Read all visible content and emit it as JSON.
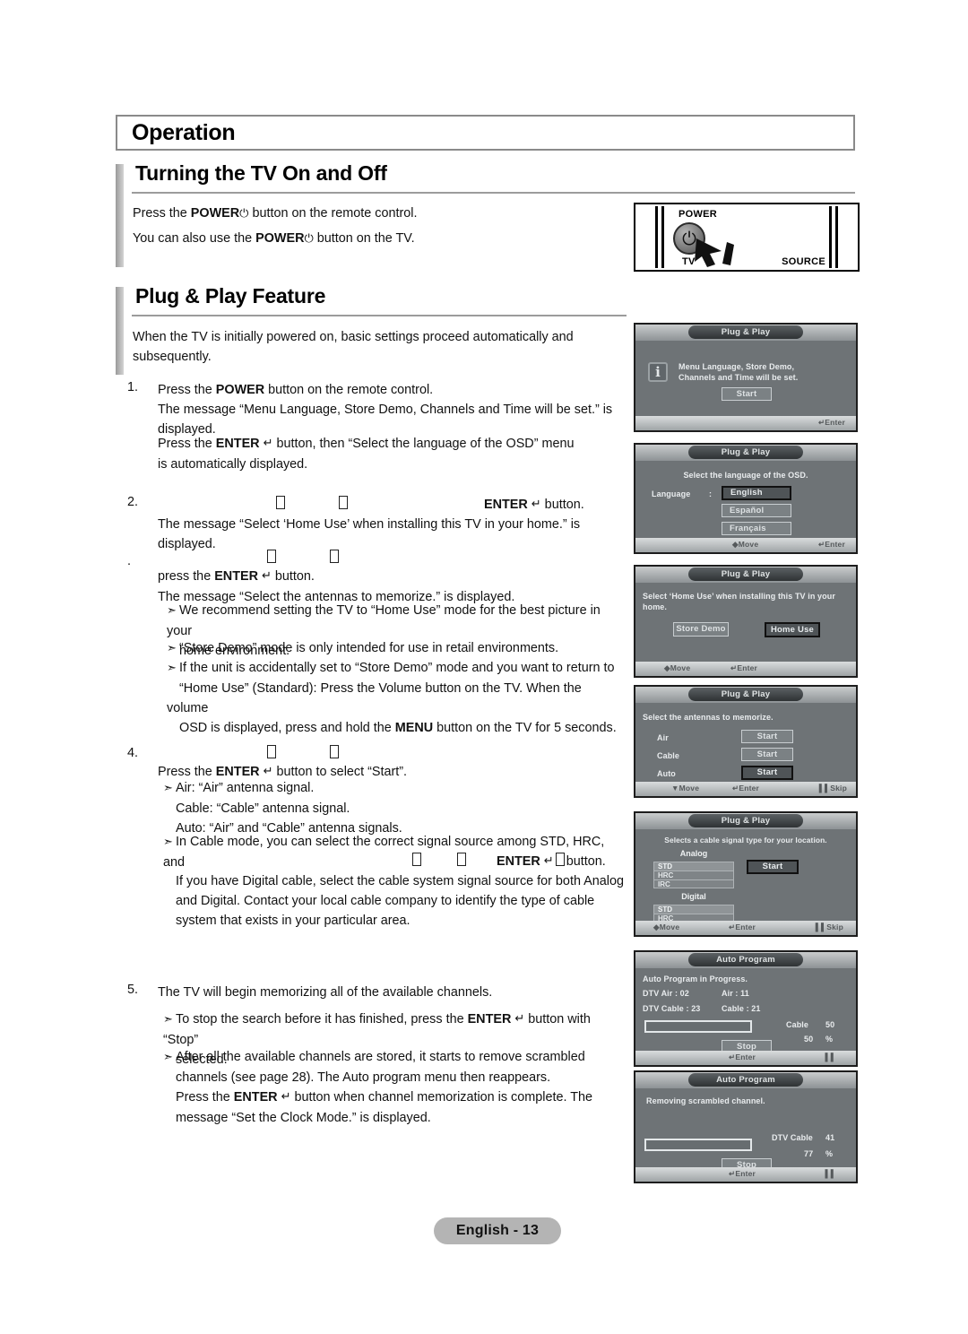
{
  "chapter": {
    "title": "Operation"
  },
  "sections": {
    "turning_on": {
      "title": "Turning the TV On and Off",
      "line1_pre": "Press the ",
      "line1_bold": "POWER",
      "line1_post": " button on the remote control.",
      "line2_pre": "You can also use the ",
      "line2_bold": "POWER",
      "line2_post": " button on the TV."
    },
    "plug_play": {
      "title": "Plug & Play Feature",
      "intro": "When the TV is initially powered on, basic settings proceed automatically and subsequently."
    }
  },
  "power_figure": {
    "power_label": "POWER",
    "tv_label": "TV",
    "source_label": "SOURCE",
    "power_glyph": "⏻"
  },
  "steps": {
    "s1": {
      "num": "1.",
      "l1_pre": "Press the ",
      "l1_bold": "POWER",
      "l1_post": " button on the remote control.",
      "l2": "The message “Menu Language, Store Demo, Channels and Time will be set.” is",
      "l3": "displayed.",
      "l4_pre": "Press the ",
      "l4_bold": "ENTER",
      "l4_post": " button, then “Select the language of the OSD” menu",
      "l5": "is automatically displayed."
    },
    "s2": {
      "num": "2.",
      "l1_bold": "ENTER",
      "l1_post": " button.",
      "l2": "The message “Select ‘Home Use’ when installing this TV in your home.” is",
      "l3": "displayed."
    },
    "s3": {
      "num": ".",
      "l2_pre": "press the ",
      "l2_bold": "ENTER",
      "l2_post": " button.",
      "l3": "The message “Select the antennas to memorize.” is displayed.",
      "b1_a": "We recommend setting the TV to “Home Use” mode for the best picture in your",
      "b1_b": "home environment.",
      "b2": "“Store Demo” mode is only intended for use in retail environments.",
      "b3_a": "If the unit is accidentally set to “Store Demo” mode and you want to return to",
      "b3_b": "“Home Use” (Standard): Press the Volume button on the TV. When the volume",
      "b3_c_pre": "OSD is displayed, press and hold the ",
      "b3_c_bold": "MENU",
      "b3_c_post": " button on the TV for 5 seconds."
    },
    "s4": {
      "num": "4.",
      "l1_pre": "Press the ",
      "l1_bold": "ENTER",
      "l1_post": " button to select “Start”.",
      "b1_a": "Air: “Air” antenna signal.",
      "b1_b": "Cable: “Cable” antenna signal.",
      "b1_c": "Auto: “Air” and “Cable” antenna signals.",
      "b2_a": "In Cable mode, you can select the correct signal source among STD, HRC, and",
      "b2_b_bold": "ENTER",
      "b2_b_post": "button.",
      "b2_c": "If you have Digital cable, select the cable system signal source for both Analog",
      "b2_d": "and Digital. Contact your local cable company to identify the type of cable",
      "b2_e": "system that exists in your particular area."
    },
    "s5": {
      "num": "5.",
      "l1": "The TV will begin memorizing all of the available channels.",
      "b1_a_pre": "To stop the search before it has finished, press the ",
      "b1_a_bold": "ENTER",
      "b1_a_post": " button with “Stop”",
      "b1_b": "selected.",
      "b2_a": "After all the available channels are stored, it starts to remove scrambled",
      "b2_b": "channels (see page 28). The Auto program menu then reappears.",
      "b2_c_pre": "Press the ",
      "b2_c_bold": "ENTER",
      "b2_c_post": " button when channel memorization is complete. The",
      "b2_d": "message “Set the Clock Mode.” is displayed."
    }
  },
  "osd": {
    "p1": {
      "title": "Plug & Play",
      "info_glyph": "i",
      "msg_l1": "Menu Language, Store Demo,",
      "msg_l2": "Channels and Time will be set.",
      "start": "Start",
      "hint_enter": "Enter"
    },
    "p2": {
      "title": "Plug & Play",
      "msg": "Select the language of the OSD.",
      "language_label": "Language",
      "colon": ":",
      "options": [
        "English",
        "Español",
        "Français"
      ],
      "hint_move": "Move",
      "hint_enter": "Enter"
    },
    "p3": {
      "title": "Plug & Play",
      "msg_l1": "Select ‘Home Use’ when installing this TV in your",
      "msg_l2": "home.",
      "store_demo": "Store Demo",
      "home_use": "Home Use",
      "hint_move": "Move",
      "hint_enter": "Enter"
    },
    "p4": {
      "title": "Plug & Play",
      "msg": "Select the antennas to memorize.",
      "rows": [
        "Air",
        "Cable",
        "Auto"
      ],
      "start": "Start",
      "hint_move": "Move",
      "hint_enter": "Enter",
      "hint_skip": "Skip"
    },
    "p5": {
      "title": "Plug & Play",
      "msg": "Selects a cable signal type for your location.",
      "analog_label": "Analog",
      "digital_label": "Digital",
      "options": [
        "STD",
        "HRC",
        "IRC"
      ],
      "start": "Start",
      "hint_move": "Move",
      "hint_enter": "Enter",
      "hint_skip": "Skip"
    },
    "p6": {
      "title": "Auto Program",
      "msg": "Auto Program in Progress.",
      "dtv_air": "DTV Air : 02",
      "air": "Air : 11",
      "dtv_cable": "DTV Cable : 23",
      "cable": "Cable : 21",
      "stat_label": "Cable",
      "stat_value": "50",
      "percent_value": "50",
      "percent_sign": "%",
      "stop": "Stop",
      "hint_enter": "Enter"
    },
    "p7": {
      "title": "Auto Program",
      "msg": "Removing scrambled channel.",
      "stat_label": "DTV Cable",
      "stat_value": "41",
      "percent_value": "77",
      "percent_sign": "%",
      "stop": "Stop",
      "hint_enter": "Enter"
    }
  },
  "footer": {
    "page_label": "English - 13"
  }
}
